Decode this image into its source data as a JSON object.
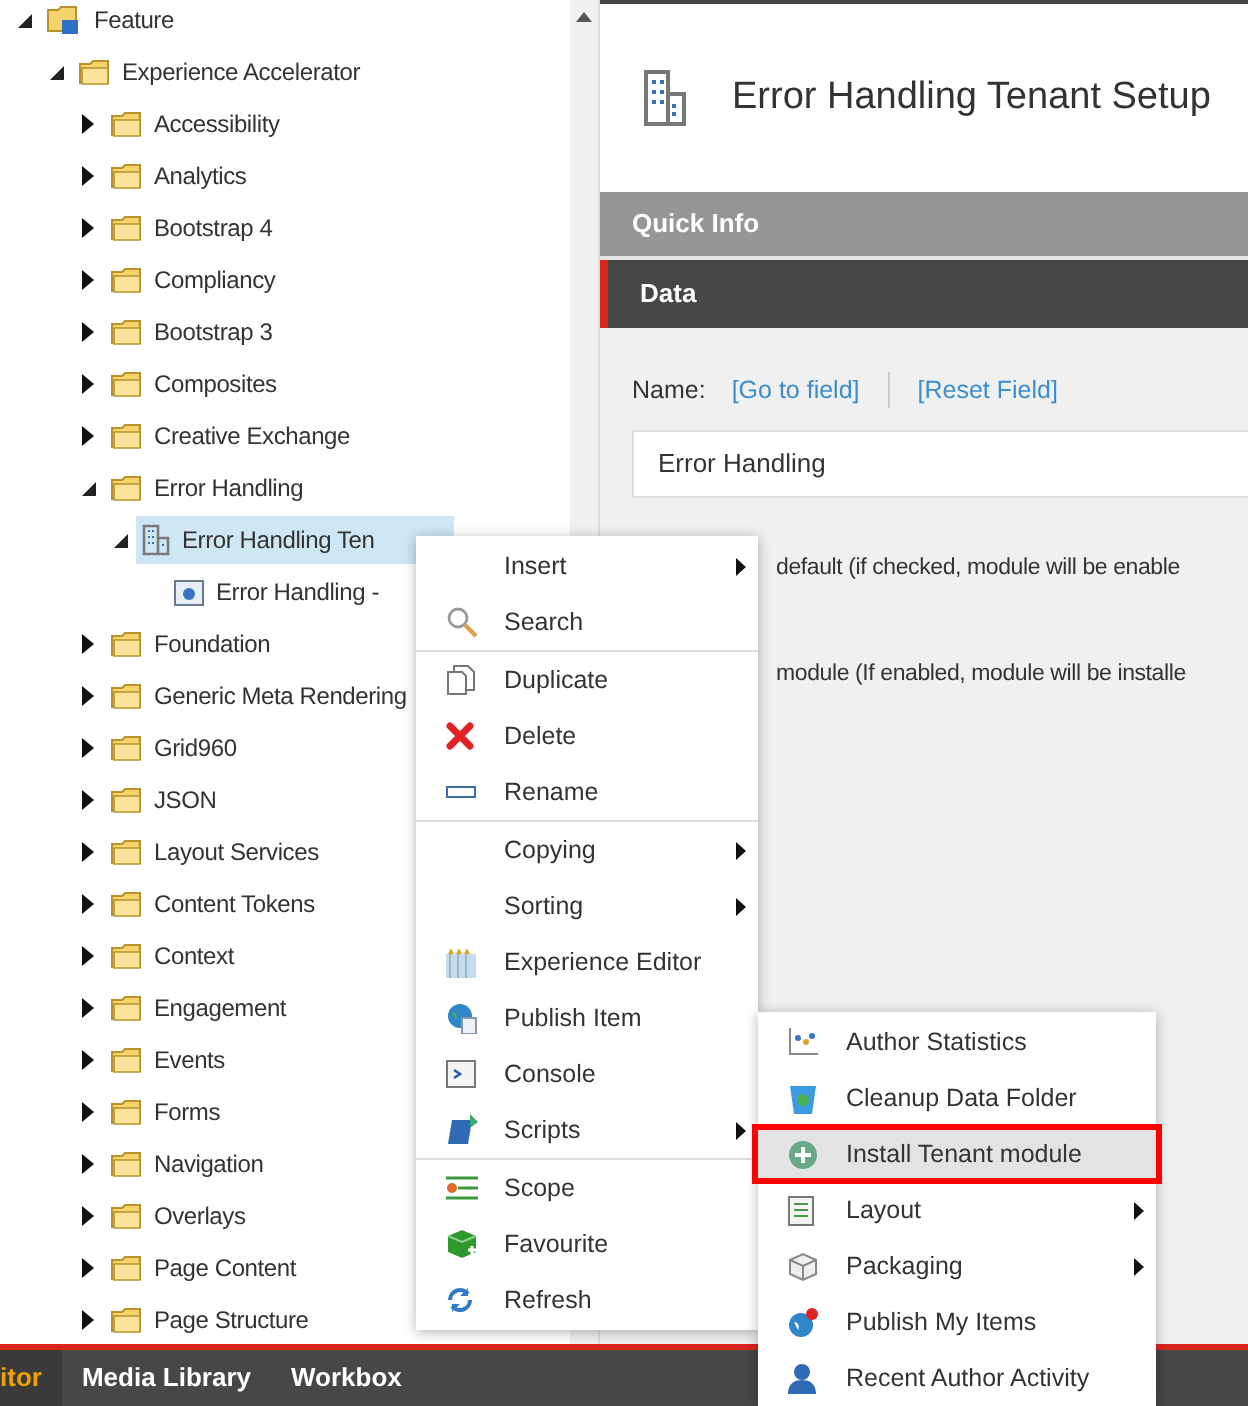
{
  "tree": [
    {
      "label": "Feature",
      "kind": "feature",
      "expanded": true,
      "selected": false,
      "children": [
        {
          "label": "Experience Accelerator",
          "kind": "folder",
          "expanded": true,
          "selected": false,
          "children": [
            {
              "label": "Accessibility",
              "kind": "folder",
              "expanded": false,
              "selected": false
            },
            {
              "label": "Analytics",
              "kind": "folder",
              "expanded": false,
              "selected": false
            },
            {
              "label": "Bootstrap 4",
              "kind": "folder",
              "expanded": false,
              "selected": false
            },
            {
              "label": "Compliancy",
              "kind": "folder",
              "expanded": false,
              "selected": false
            },
            {
              "label": "Bootstrap 3",
              "kind": "folder",
              "expanded": false,
              "selected": false
            },
            {
              "label": "Composites",
              "kind": "folder",
              "expanded": false,
              "selected": false
            },
            {
              "label": "Creative Exchange",
              "kind": "folder",
              "expanded": false,
              "selected": false
            },
            {
              "label": "Error Handling",
              "kind": "folder",
              "expanded": true,
              "selected": false,
              "children": [
                {
                  "label": "Error Handling Ten",
                  "kind": "building",
                  "expanded": true,
                  "selected": true,
                  "children": [
                    {
                      "label": "Error Handling -",
                      "kind": "item",
                      "selected": false
                    }
                  ]
                }
              ]
            },
            {
              "label": "Foundation",
              "kind": "folder",
              "expanded": false,
              "selected": false
            },
            {
              "label": "Generic Meta Rendering",
              "kind": "folder",
              "expanded": false,
              "selected": false
            },
            {
              "label": "Grid960",
              "kind": "folder",
              "expanded": false,
              "selected": false
            },
            {
              "label": "JSON",
              "kind": "folder",
              "expanded": false,
              "selected": false
            },
            {
              "label": "Layout Services",
              "kind": "folder",
              "expanded": false,
              "selected": false
            },
            {
              "label": "Content Tokens",
              "kind": "folder",
              "expanded": false,
              "selected": false
            },
            {
              "label": "Context",
              "kind": "folder",
              "expanded": false,
              "selected": false
            },
            {
              "label": "Engagement",
              "kind": "folder",
              "expanded": false,
              "selected": false
            },
            {
              "label": "Events",
              "kind": "folder",
              "expanded": false,
              "selected": false
            },
            {
              "label": "Forms",
              "kind": "folder",
              "expanded": false,
              "selected": false
            },
            {
              "label": "Navigation",
              "kind": "folder",
              "expanded": false,
              "selected": false
            },
            {
              "label": "Overlays",
              "kind": "folder",
              "expanded": false,
              "selected": false
            },
            {
              "label": "Page Content",
              "kind": "folder",
              "expanded": false,
              "selected": false
            },
            {
              "label": "Page Structure",
              "kind": "folder",
              "expanded": false,
              "selected": false
            }
          ]
        }
      ]
    }
  ],
  "editor": {
    "title": "Error Handling Tenant Setup",
    "sections": [
      {
        "label": "Quick Info",
        "selected": false
      },
      {
        "label": "Data",
        "selected": true
      }
    ],
    "field": {
      "label": "Name:",
      "links": [
        "[Go to field]",
        "[Reset Field]"
      ],
      "value": "Error Handling"
    },
    "options": [
      "default (if checked, module will be enable",
      "module (If enabled, module will be installe"
    ]
  },
  "context_menu": [
    {
      "label": "Insert",
      "kind": "none",
      "submenu": true,
      "separator_before": false
    },
    {
      "label": "Search",
      "kind": "search",
      "submenu": false,
      "separator_before": false
    },
    {
      "label": "Duplicate",
      "kind": "duplicate",
      "submenu": false,
      "separator_before": true
    },
    {
      "label": "Delete",
      "kind": "delete",
      "submenu": false,
      "separator_before": false
    },
    {
      "label": "Rename",
      "kind": "rename",
      "submenu": false,
      "separator_before": false
    },
    {
      "label": "Copying",
      "kind": "none",
      "submenu": true,
      "separator_before": true
    },
    {
      "label": "Sorting",
      "kind": "none",
      "submenu": true,
      "separator_before": false
    },
    {
      "label": "Experience Editor",
      "kind": "crayons",
      "submenu": false,
      "separator_before": false
    },
    {
      "label": "Publish Item",
      "kind": "globe",
      "submenu": false,
      "separator_before": false
    },
    {
      "label": "Console",
      "kind": "console",
      "submenu": false,
      "separator_before": false
    },
    {
      "label": "Scripts",
      "kind": "script",
      "submenu": true,
      "separator_before": false
    },
    {
      "label": "Scope",
      "kind": "scope",
      "submenu": false,
      "separator_before": true
    },
    {
      "label": "Favourite",
      "kind": "cube",
      "submenu": false,
      "separator_before": false
    },
    {
      "label": "Refresh",
      "kind": "refresh",
      "submenu": false,
      "separator_before": false
    }
  ],
  "submenu": [
    {
      "label": "Author Statistics",
      "kind": "stats",
      "submenu": false,
      "selected": false
    },
    {
      "label": "Cleanup Data Folder",
      "kind": "bin",
      "submenu": false,
      "selected": false
    },
    {
      "label": "Install Tenant module",
      "kind": "plus",
      "submenu": false,
      "selected": true
    },
    {
      "label": "Layout",
      "kind": "layout",
      "submenu": true,
      "selected": false
    },
    {
      "label": "Packaging",
      "kind": "package",
      "submenu": true,
      "selected": false
    },
    {
      "label": "Publish My Items",
      "kind": "globe-pin",
      "submenu": false,
      "selected": false
    },
    {
      "label": "Recent Author Activity",
      "kind": "person",
      "submenu": false,
      "selected": false
    }
  ],
  "bottom_tabs": [
    {
      "label": "itor",
      "selected": true
    },
    {
      "label": "Media Library",
      "selected": false
    },
    {
      "label": "Workbox",
      "selected": false
    }
  ]
}
